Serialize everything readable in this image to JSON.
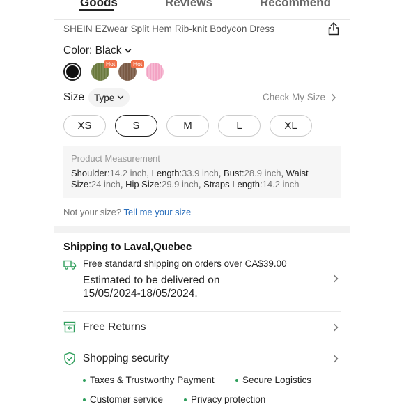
{
  "tabs": [
    {
      "label": "Goods"
    },
    {
      "label": "Reviews"
    },
    {
      "label": "Recommend"
    }
  ],
  "product": {
    "title": "SHEIN EZwear Split Hem Rib-knit Bodycon Dress"
  },
  "color": {
    "label": "Color: Black",
    "swatches": [
      {
        "name": "Black",
        "hex": "#111111",
        "selected": true,
        "badge": ""
      },
      {
        "name": "Olive",
        "hex": "#6b7a3e",
        "selected": false,
        "badge": "Hot"
      },
      {
        "name": "Brown",
        "hex": "#7a5a45",
        "selected": false,
        "badge": "Hot"
      },
      {
        "name": "Pink",
        "hex": "#f3a3c4",
        "selected": false,
        "badge": ""
      }
    ],
    "hot_color": "#f0704a"
  },
  "size": {
    "label": "Size",
    "type_chip": "Type",
    "check_link": "Check My Size",
    "options": [
      "XS",
      "S",
      "M",
      "L",
      "XL"
    ],
    "selected": "S"
  },
  "measurement": {
    "title": "Product Measurement",
    "shoulder_label": "Shoulder:",
    "shoulder_value": "14.2 inch",
    "length_label": "Length:",
    "length_value": "33.9 inch",
    "bust_label": "Bust:",
    "bust_value": "28.9 inch",
    "waist_label": "Waist Size:",
    "waist_value": "24 inch",
    "hip_label": "Hip Size:",
    "hip_value": "29.9 inch",
    "straps_label": "Straps Length:",
    "straps_value": "14.2 inch"
  },
  "not_your_size": {
    "prefix": "Not your size? ",
    "link": "Tell me your size"
  },
  "shipping": {
    "title": "Shipping to Laval,Quebec",
    "free_line": "Free standard shipping on orders over CA$39.00",
    "estimate_line1": "Estimated to be delivered on",
    "estimate_line2": "15/05/2024-18/05/2024."
  },
  "returns": {
    "label": "Free Returns"
  },
  "security": {
    "label": "Shopping security",
    "items": [
      "Taxes & Trustworthy Payment",
      "Secure Logistics",
      "Customer service",
      "Privacy protection"
    ],
    "accent": "#2e9e5b"
  }
}
